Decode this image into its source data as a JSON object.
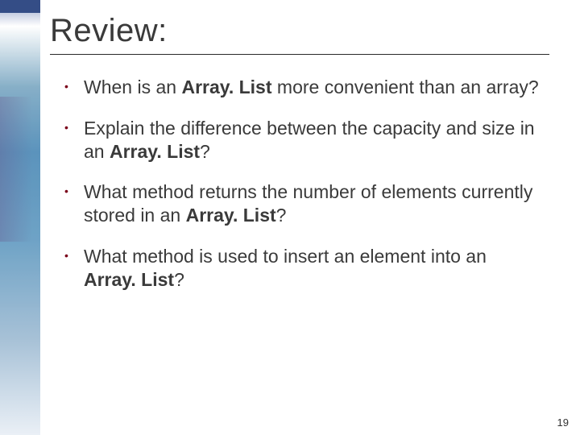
{
  "title": "Review:",
  "bold_term": "Array. List",
  "bullets": [
    {
      "pre": "When is an ",
      "post": " more convenient than an array?"
    },
    {
      "pre": "Explain the difference between the capacity and size in an ",
      "post": "?"
    },
    {
      "pre": "What method returns the number of elements currently stored in an ",
      "post": "?"
    },
    {
      "pre": "What method is used to insert an element into an ",
      "post": "?"
    }
  ],
  "page_number": "19"
}
